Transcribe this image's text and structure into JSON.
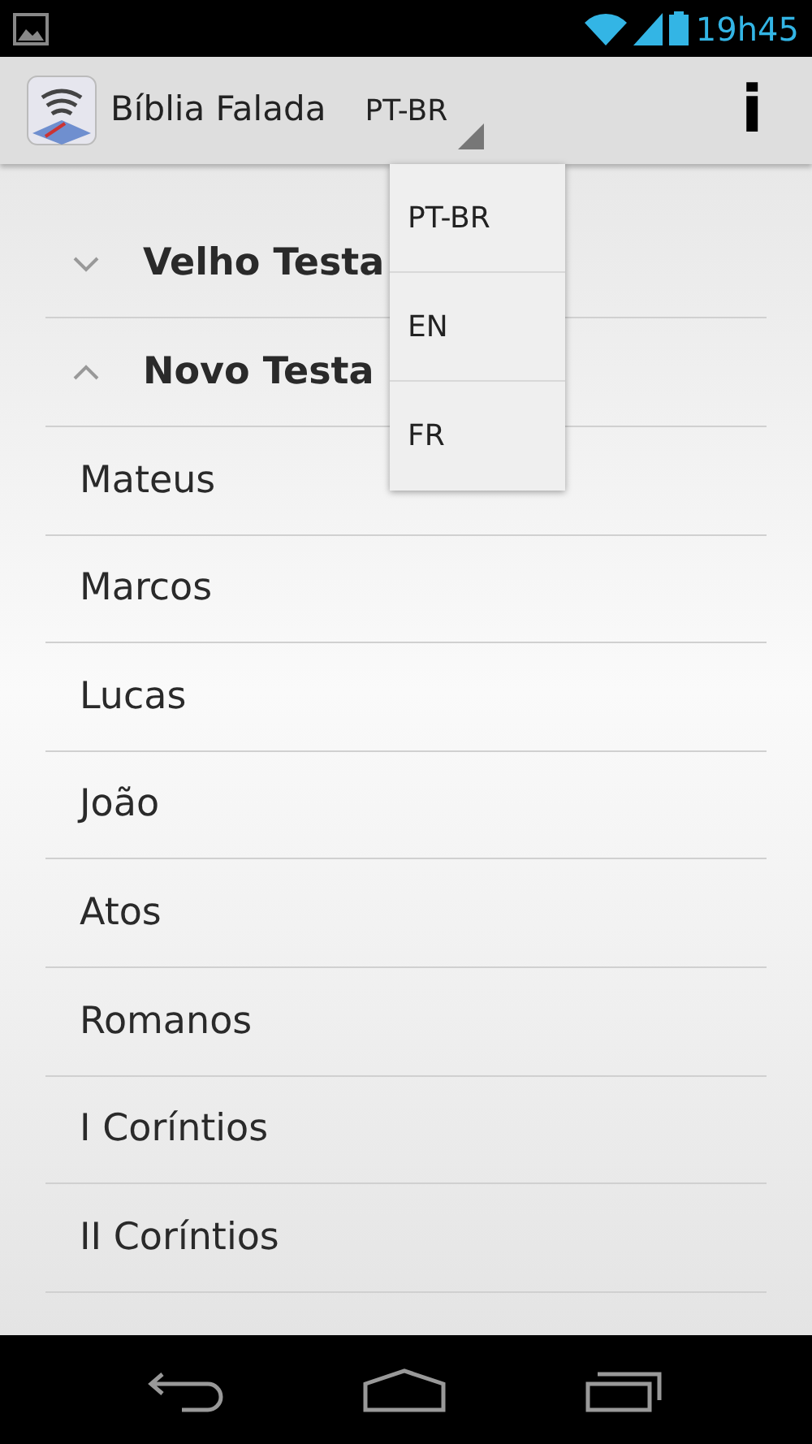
{
  "status_bar": {
    "time": "19h45"
  },
  "action_bar": {
    "title": "Bíblia Falada",
    "language": "PT-BR",
    "info": "i"
  },
  "groups": [
    {
      "title": "Velho Testa",
      "expanded": false
    },
    {
      "title": "Novo Testa",
      "expanded": true
    }
  ],
  "books": [
    "Mateus",
    "Marcos",
    "Lucas",
    "João",
    "Atos",
    "Romanos",
    "I Coríntios",
    "II Coríntios"
  ],
  "language_menu": [
    "PT-BR",
    "EN",
    "FR"
  ]
}
